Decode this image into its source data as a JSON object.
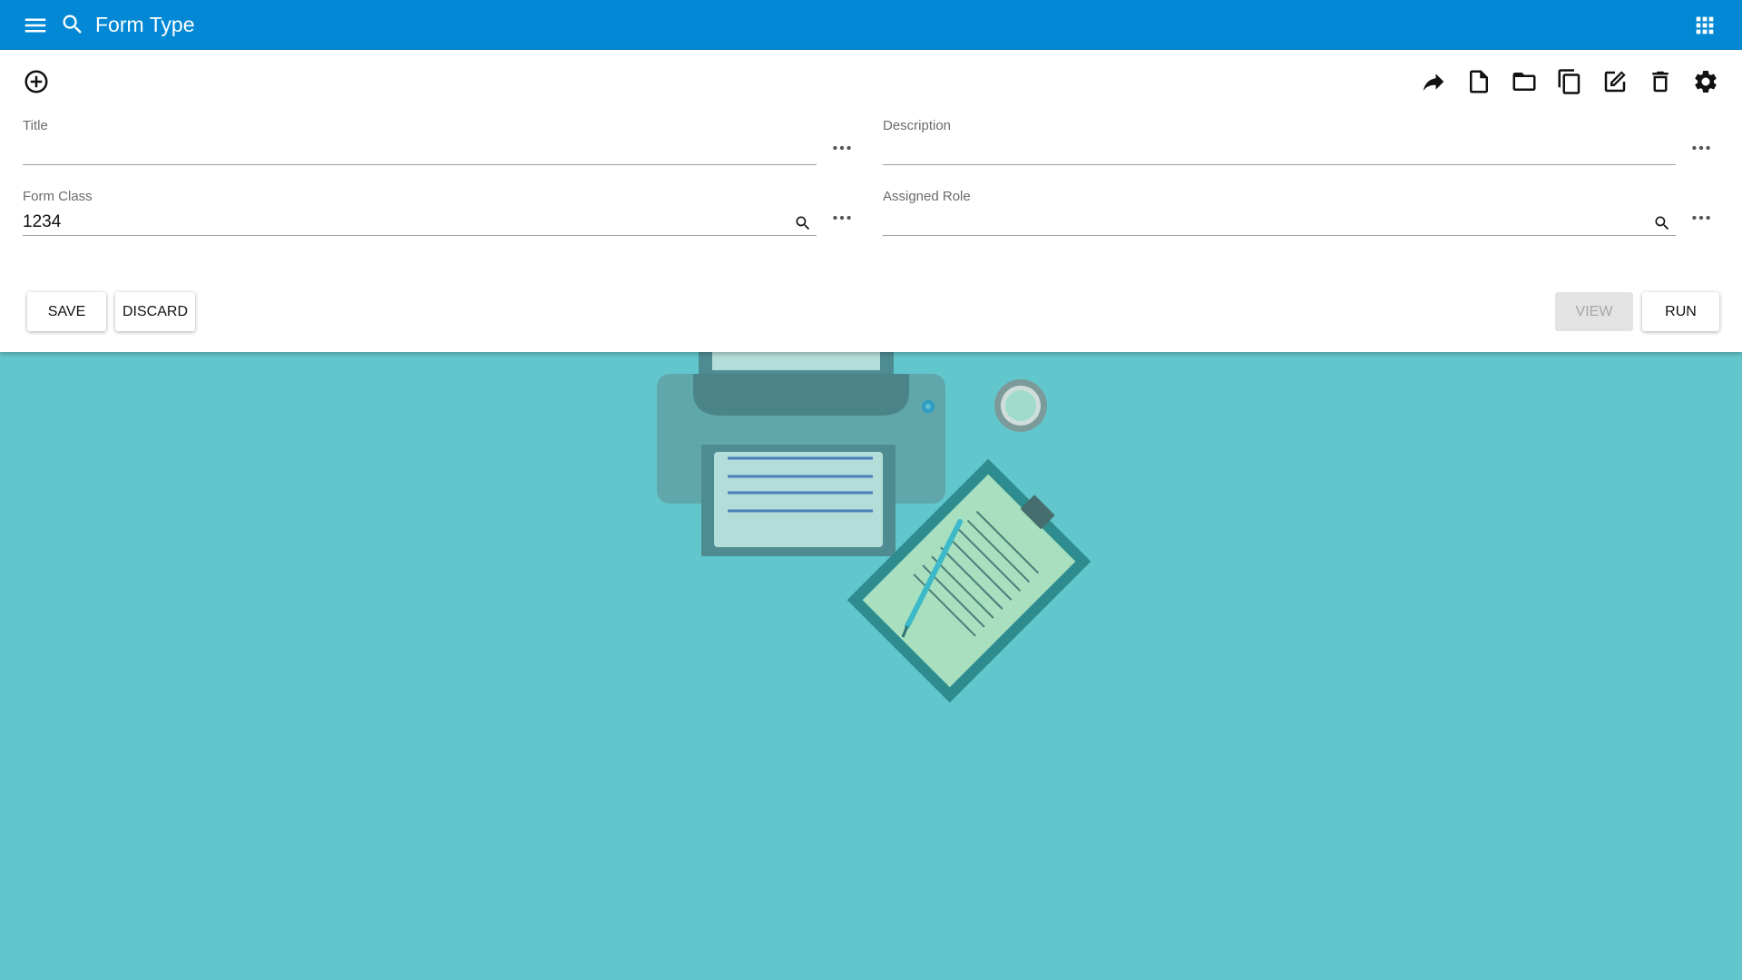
{
  "header": {
    "title": "Form Type",
    "menu_icon": "menu-icon",
    "search_icon": "search-icon",
    "apps_icon": "apps-grid-icon"
  },
  "toolbar": {
    "add_icon": "add-circle-icon",
    "actions": [
      "share-icon",
      "new-document-icon",
      "folder-icon",
      "copy-icon",
      "edit-icon",
      "delete-icon",
      "settings-icon"
    ]
  },
  "form": {
    "title": {
      "label": "Title",
      "value": ""
    },
    "description": {
      "label": "Description",
      "value": ""
    },
    "form_class": {
      "label": "Form Class",
      "value": "1234"
    },
    "assigned_role": {
      "label": "Assigned Role",
      "value": ""
    }
  },
  "buttons": {
    "save": "SAVE",
    "discard": "DISCARD",
    "view": "VIEW",
    "run": "RUN"
  },
  "colors": {
    "header": "#0288d4",
    "background": "#62c7cc",
    "panel": "#ffffff"
  }
}
